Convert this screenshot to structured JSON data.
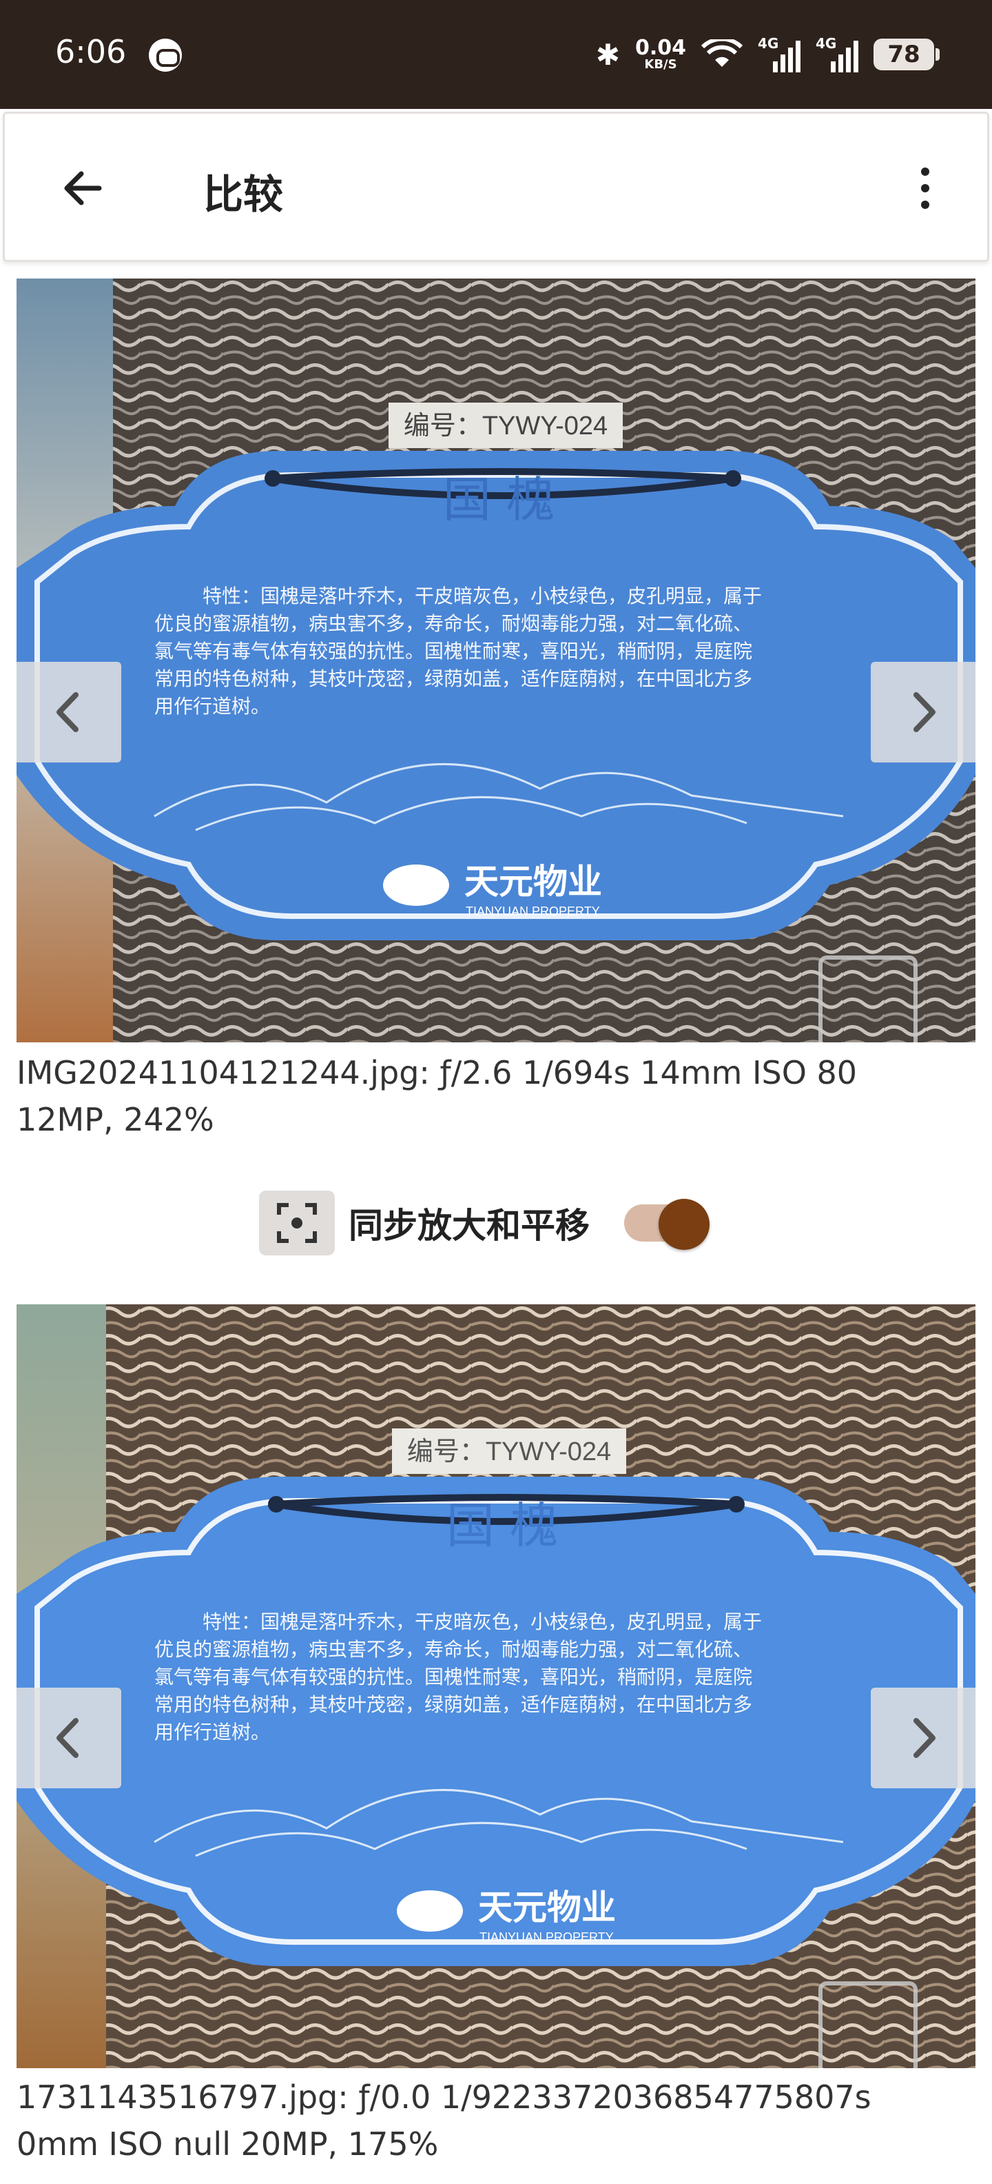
{
  "status_bar": {
    "time": "6:06",
    "network_speed_value": "0.04",
    "network_speed_unit": "KB/S",
    "signal_1_label": "4G",
    "signal_2_label": "4G",
    "battery_level": "78",
    "background_color": "#2e221c"
  },
  "app_bar": {
    "title": "比较",
    "back_icon": "arrow-left-icon",
    "menu_icon": "more-vert-icon"
  },
  "photo_1": {
    "sign": {
      "number": "编号：TYWY-024",
      "name": "国 槐",
      "description_lines": [
        "特性：国槐是落叶乔木，干皮暗灰色，小枝绿色，皮孔明显，属于",
        "优良的蜜源植物，病虫害不多，寿命长，耐烟毒能力强，对二氧化硫、",
        "氯气等有毒气体有较强的抗性。国槐性耐寒，喜阳光，稍耐阴，是庭院",
        "常用的特色树种，其枝叶茂密，绿荫如盖，适作庭荫树，在中国北方多",
        "用作行道树。"
      ],
      "logo_text": "天元物业",
      "logo_subtext": "TIANYUAN PROPERTY"
    },
    "info_line_1": "IMG20241104121244.jpg: ƒ/2.6 1/694s 14mm ISO 80",
    "info_line_2": "12MP, 242%"
  },
  "sync": {
    "label": "同步放大和平移",
    "enabled": true,
    "toggle_color": "#7a3e12"
  },
  "photo_2": {
    "sign": {
      "number": "编号：TYWY-024",
      "name": "国 槐",
      "description_lines": [
        "特性：国槐是落叶乔木，干皮暗灰色，小枝绿色，皮孔明显，属于",
        "优良的蜜源植物，病虫害不多，寿命长，耐烟毒能力强，对二氧化硫、",
        "氯气等有毒气体有较强的抗性。国槐性耐寒，喜阳光，稍耐阴，是庭院",
        "常用的特色树种，其枝叶茂密，绿荫如盖，适作庭荫树，在中国北方多",
        "用作行道树。"
      ],
      "logo_text": "天元物业",
      "logo_subtext": "TIANYUAN PROPERTY"
    },
    "info_line_1": "1731143516797.jpg: ƒ/0.0 1/9223372036854775807s",
    "info_line_2": "0mm ISO null 20MP, 175%"
  },
  "colors": {
    "sign_blue": "#4a86d6",
    "sign_blue_light": "#6da3e8",
    "bark_dark": "#2f2a27",
    "bark_light": "#8a817a"
  }
}
